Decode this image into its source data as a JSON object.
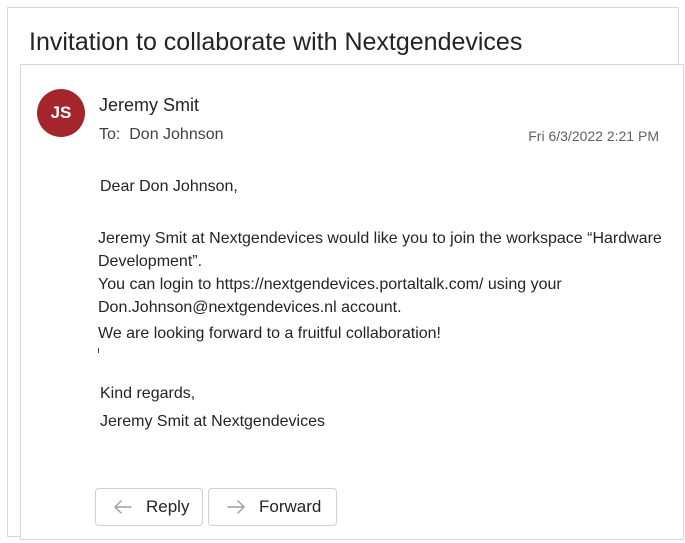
{
  "subject": "Invitation to collaborate with Nextgendevices",
  "message": {
    "avatar_initials": "JS",
    "avatar_color": "#a4262c",
    "sender": "Jeremy Smit",
    "to_label": "To:",
    "to_name": "Don Johnson",
    "date": "Fri 6/3/2022 2:21 PM",
    "greeting": "Dear Don Johnson,",
    "body_lines": [
      "Jeremy Smit at Nextgendevices would like you to join the workspace “Hardware",
      "Development”.",
      "You can login to https://nextgendevices.portaltalk.com/ using your",
      "Don.Johnson@nextgendevices.nl account."
    ],
    "closing_line": "We are looking forward to a fruitful collaboration!",
    "signoff": "Kind regards,",
    "signature": "Jeremy Smit at Nextgendevices"
  },
  "actions": {
    "reply_label": "Reply",
    "forward_label": "Forward",
    "reply_icon": "reply-arrow-icon",
    "forward_icon": "forward-arrow-icon"
  }
}
